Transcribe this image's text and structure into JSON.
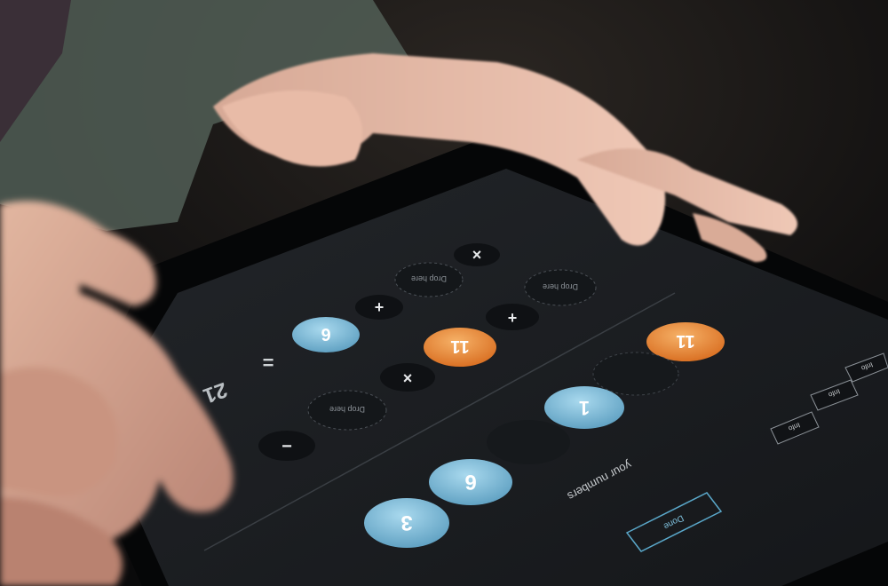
{
  "screen": {
    "top_chips": [
      {
        "id": "mult-top",
        "text": "×",
        "kind": "operator"
      },
      {
        "id": "drop-top",
        "text": "Drop here",
        "kind": "drop"
      },
      {
        "id": "plus-top",
        "text": "+",
        "kind": "operator"
      },
      {
        "id": "drop-mid",
        "text": "Drop here",
        "kind": "drop"
      },
      {
        "id": "plus-right",
        "text": "+",
        "kind": "operator"
      },
      {
        "id": "drop-right",
        "text": "Drop here",
        "kind": "drop"
      }
    ],
    "numbers": [
      {
        "id": "nine-top",
        "text": "6",
        "color": "blue"
      },
      {
        "id": "eleven-mid",
        "text": "11",
        "color": "orange"
      },
      {
        "id": "eleven-right",
        "text": "11",
        "color": "orange"
      },
      {
        "id": "one",
        "text": "1",
        "color": "blue"
      },
      {
        "id": "six",
        "text": "6",
        "color": "blue"
      },
      {
        "id": "three",
        "text": "3",
        "color": "blue"
      }
    ],
    "operators_lower": [
      {
        "id": "equals",
        "text": "="
      },
      {
        "id": "times-lower",
        "text": "×"
      },
      {
        "id": "minus",
        "text": "−"
      }
    ],
    "partial_left_label": "21",
    "prompt_label": "your numbers",
    "action_button": "Done",
    "small_buttons": [
      "Info",
      "Info",
      "Info"
    ],
    "colors": {
      "blue": "#7ab9d6",
      "orange": "#e98a3b",
      "screen_bg": "#1b1e22",
      "chip_bg": "#0f1114"
    }
  }
}
